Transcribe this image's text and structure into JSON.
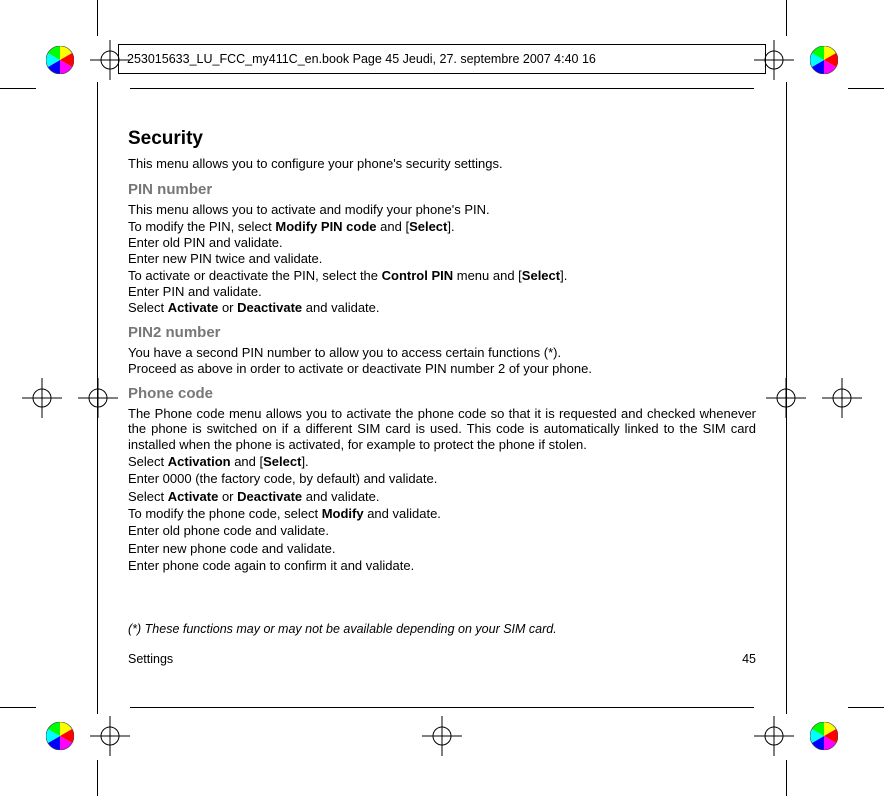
{
  "header": {
    "text": "253015633_LU_FCC_my411C_en.book  Page 45  Jeudi, 27. septembre 2007  4:40 16"
  },
  "security": {
    "title": "Security",
    "intro": "This menu allows you to configure your phone's security settings."
  },
  "pin": {
    "heading": "PIN number",
    "l1": "This menu allows you to activate and modify your phone's PIN.",
    "l2a": "To modify the PIN, select ",
    "l2b": "Modify PIN code",
    "l2c": " and [",
    "l2d": "Select",
    "l2e": "].",
    "l3": "Enter old PIN and validate.",
    "l4": "Enter new PIN twice and validate.",
    "l5a": "To activate or deactivate the PIN, select the ",
    "l5b": "Control PIN",
    "l5c": " menu and [",
    "l5d": "Select",
    "l5e": "].",
    "l6": "Enter PIN and validate.",
    "l7a": "Select ",
    "l7b": "Activate",
    "l7c": " or ",
    "l7d": "Deactivate",
    "l7e": " and validate."
  },
  "pin2": {
    "heading": "PIN2 number",
    "l1": "You have a second PIN number to allow you to access certain functions (*).",
    "l2": "Proceed as above in order to activate or deactivate PIN number 2 of your phone."
  },
  "phonecode": {
    "heading": "Phone code",
    "p1": "The Phone code menu allows you to activate the phone code so that it is requested and checked whenever the phone is switched on if a different SIM card is used. This code is automatically linked to the SIM card installed when the phone is activated, for example to protect the phone if stolen.",
    "l2a": "Select ",
    "l2b": "Activation",
    "l2c": " and [",
    "l2d": "Select",
    "l2e": "].",
    "l3": "Enter 0000 (the factory code, by default) and validate.",
    "l4a": "Select ",
    "l4b": "Activate",
    "l4c": " or ",
    "l4d": "Deactivate",
    "l4e": " and validate.",
    "l5a": "To modify the phone code, select ",
    "l5b": "Modify",
    "l5c": " and validate.",
    "l6": "Enter old phone code and validate.",
    "l7": "Enter new phone code and validate.",
    "l8": "Enter phone code again to confirm it and validate."
  },
  "footnote": {
    "text": "(*)    These functions may or may not be available depending on your SIM card."
  },
  "footer": {
    "left": "Settings",
    "right": "45"
  }
}
